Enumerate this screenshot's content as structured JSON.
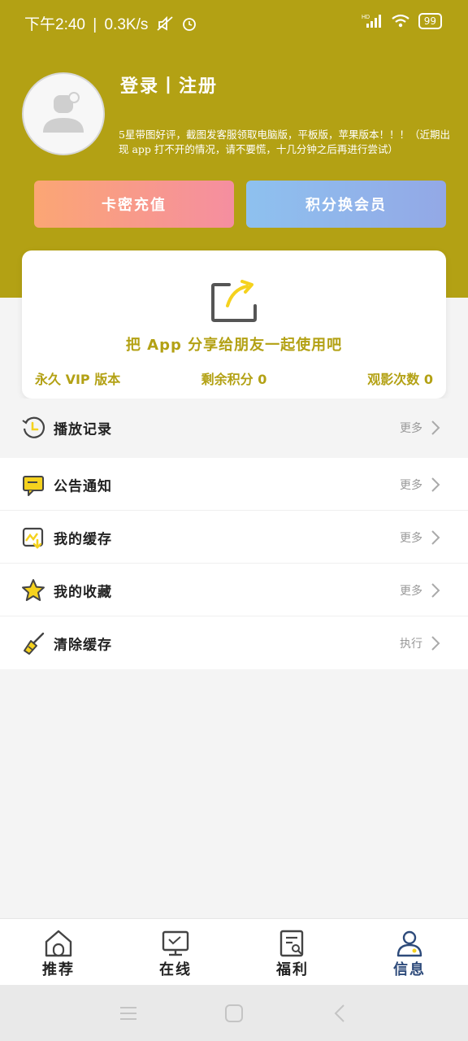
{
  "status_bar": {
    "time": "下午2:40",
    "separator": "|",
    "speed": "0.3K/s",
    "battery": "99",
    "net_label": "HD"
  },
  "header": {
    "login": "登录丨注册",
    "notice": "5星带图好评，截图发客服领取电脑版，平板版，苹果版本！！！（近期出现 app 打不开的情况，请不要慌，十几分钟之后再进行尝试）",
    "btn_card": "卡密充值",
    "btn_vip": "积分换会员",
    "bg_color": "#b3a114"
  },
  "share": {
    "text": "把 App 分享给朋友一起使用吧",
    "vip": "永久 VIP 版本",
    "points": "剩余积分 0",
    "views": "观影次数 0"
  },
  "menu": {
    "history": {
      "label": "播放记录",
      "more": "更多",
      "icon": "history-clock-icon"
    },
    "notice": {
      "label": "公告通知",
      "more": "更多",
      "icon": "message-icon"
    },
    "cache": {
      "label": "我的缓存",
      "more": "更多",
      "icon": "download-icon"
    },
    "fav": {
      "label": "我的收藏",
      "more": "更多",
      "icon": "star-icon"
    },
    "clear": {
      "label": "清除缓存",
      "more": "执行",
      "icon": "broom-icon"
    }
  },
  "tabs": [
    {
      "label": "推荐",
      "icon": "home-icon"
    },
    {
      "label": "在线",
      "icon": "tv-icon"
    },
    {
      "label": "福利",
      "icon": "document-search-icon"
    },
    {
      "label": "信息",
      "icon": "user-icon",
      "active": true
    }
  ],
  "colors": {
    "accent": "#b3a114",
    "active_tab": "#2d4a7a",
    "icon_yellow": "#f5d21e"
  }
}
